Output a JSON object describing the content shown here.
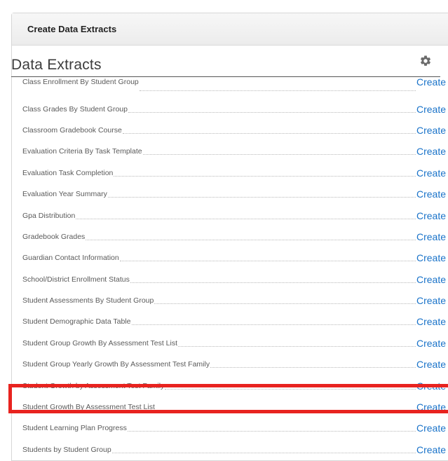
{
  "panel": {
    "title": "Create Data Extracts"
  },
  "section": {
    "title": "Data Extracts",
    "settings_icon": "gear-icon"
  },
  "extracts": [
    {
      "label": "Class Enrollment By Student Group",
      "action": "Create"
    },
    {
      "label": "Class Grades By Student Group",
      "action": "Create"
    },
    {
      "label": "Classroom Gradebook Course",
      "action": "Create"
    },
    {
      "label": "Evaluation Criteria By Task Template",
      "action": "Create"
    },
    {
      "label": "Evaluation Task Completion",
      "action": "Create"
    },
    {
      "label": "Evaluation Year Summary",
      "action": "Create"
    },
    {
      "label": "Gpa Distribution",
      "action": "Create"
    },
    {
      "label": "Gradebook Grades",
      "action": "Create"
    },
    {
      "label": "Guardian Contact Information",
      "action": "Create"
    },
    {
      "label": "School/District Enrollment Status",
      "action": "Create"
    },
    {
      "label": "Student Assessments By Student Group",
      "action": "Create"
    },
    {
      "label": "Student Demographic Data Table",
      "action": "Create"
    },
    {
      "label": "Student Group Growth By Assessment Test List",
      "action": "Create"
    },
    {
      "label": "Student Group Yearly Growth By Assessment Test Family",
      "action": "Create"
    },
    {
      "label": "Student Growth by Assessment Test Family",
      "action": "Create"
    },
    {
      "label": "Student Growth By Assessment Test List",
      "action": "Create"
    },
    {
      "label": "Student Learning Plan Progress",
      "action": "Create"
    },
    {
      "label": "Students by Student Group",
      "action": "Create"
    }
  ],
  "colors": {
    "link": "#1a73c9",
    "highlight": "#e8231f"
  }
}
